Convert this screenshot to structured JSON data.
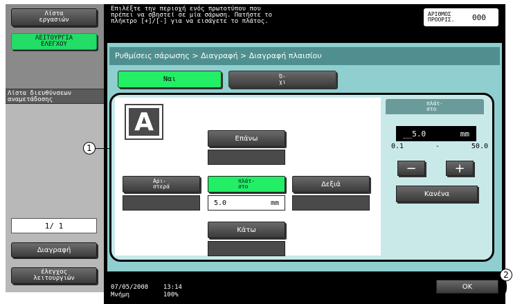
{
  "sidebar": {
    "job_list_label": "Λίστα\nεργασιών",
    "check_function_label": "ΛΕΙΤΟΥΡΓΙΑ\nΕΛΕΓΧΟΥ",
    "address_list_label": "Λίστα διευθύνσεων\nαναμετάδοσης",
    "counter": "1/ 1",
    "delete_label": "Διαγραφή",
    "check_functions_label": "έλεγχος\nλειτουργιών"
  },
  "header": {
    "message": "Επιλέξτε την περιοχή ενός πρωτοτύπου που\nπρέπει να σβηστεί σε μία σάρωση. Πατήστε το\nπλήκτρο [+]/[-] για να εισάγετε το πλάτος.",
    "dest_label": "ΑΡΙΘΜΟΣ\nΠΡΟΟΡΙΣ.",
    "dest_value": "000"
  },
  "breadcrumb": "Ρυθμίσεις σάρωσης > Διαγραφή > Διαγραφή πλαισίου",
  "toggle": {
    "yes": "Ναι",
    "no": "Ό-\nχι"
  },
  "erase": {
    "top": "Επάνω",
    "left": "Αρι-\nστερά",
    "width_btn": "πλάτ-\nστο",
    "right": "Δεξιά",
    "bottom": "Κάτω",
    "center_value": "5.0",
    "center_unit": "mm"
  },
  "width_panel": {
    "title": "πλάτ-\nστο",
    "value": "__5.0",
    "unit": "mm",
    "min": "0.1",
    "dash": "-",
    "max": "50.0",
    "minus": "−",
    "plus": "+",
    "none": "Κανένα"
  },
  "footer": {
    "date": "07/05/2008",
    "time": "13:14",
    "memory_label": "Μνήμη",
    "memory_value": "100%",
    "ok": "OK"
  },
  "callouts": {
    "one": "1",
    "two": "2"
  },
  "colors": {
    "green": "#22ee66",
    "panel": "#8fcfcf"
  }
}
